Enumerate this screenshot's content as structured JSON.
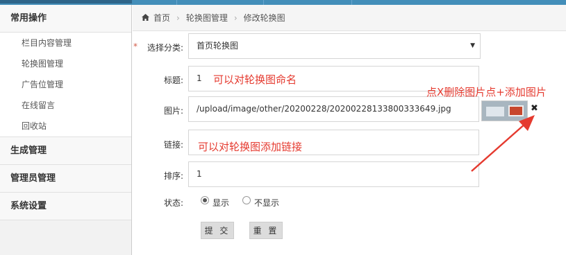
{
  "sidebar": {
    "groups": [
      {
        "label": "常用操作"
      },
      {
        "label": "生成管理"
      },
      {
        "label": "管理员管理"
      },
      {
        "label": "系统设置"
      }
    ],
    "items": [
      {
        "label": "栏目内容管理"
      },
      {
        "label": "轮换图管理"
      },
      {
        "label": "广告位管理"
      },
      {
        "label": "在线留言"
      },
      {
        "label": "回收站"
      }
    ]
  },
  "breadcrumb": {
    "home": "首页",
    "level1": "轮换图管理",
    "level2": "修改轮换图"
  },
  "form": {
    "required_mark": "*",
    "category_label": "选择分类:",
    "category_value": "首页轮换图",
    "title_label": "标题:",
    "title_value": "1",
    "image_label": "图片:",
    "image_value": "/upload/image/other/20200228/20200228133800333649.jpg",
    "remove_icon": "✖",
    "link_label": "链接:",
    "link_value": "",
    "order_label": "排序:",
    "order_value": "1",
    "status_label": "状态:",
    "status_options": [
      "显示",
      "不显示"
    ],
    "status_selected": "显示",
    "submit_label": "提 交",
    "reset_label": "重 置"
  },
  "annotations": {
    "title_note": "可以对轮换图命名",
    "image_note": "点X删除图片点+添加图片",
    "link_note": "可以对轮换图添加链接",
    "color": "#e53a2f"
  },
  "colors": {
    "topbar": "#438eb9",
    "sidebar_bg": "#f2f2f2"
  }
}
